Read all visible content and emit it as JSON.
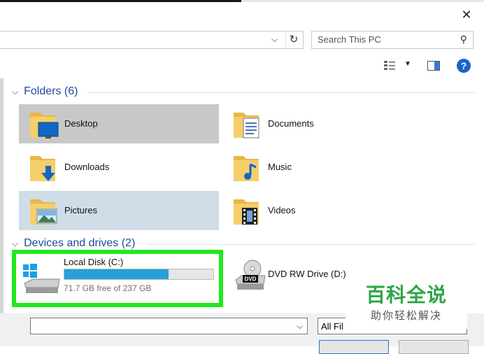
{
  "search": {
    "placeholder": "Search This PC"
  },
  "folders_group": {
    "title": "Folders (6)"
  },
  "folders": [
    {
      "label": "Desktop"
    },
    {
      "label": "Documents"
    },
    {
      "label": "Downloads"
    },
    {
      "label": "Music"
    },
    {
      "label": "Pictures"
    },
    {
      "label": "Videos"
    }
  ],
  "drives_group": {
    "title": "Devices and drives (2)"
  },
  "drives": [
    {
      "label": "Local Disk (C:)",
      "free_text": "71.7 GB free of 237 GB",
      "used_fraction": 0.7
    },
    {
      "label": "DVD RW Drive (D:)",
      "badge": "DVD"
    }
  ],
  "bottom": {
    "filter_label": "All Fil"
  },
  "watermark": {
    "title": "百科全说",
    "subtitle": "助你轻松解决"
  },
  "colors": {
    "accent": "#1e4a9b",
    "highlight": "#22e81e",
    "drive_fill": "#26a0da"
  }
}
